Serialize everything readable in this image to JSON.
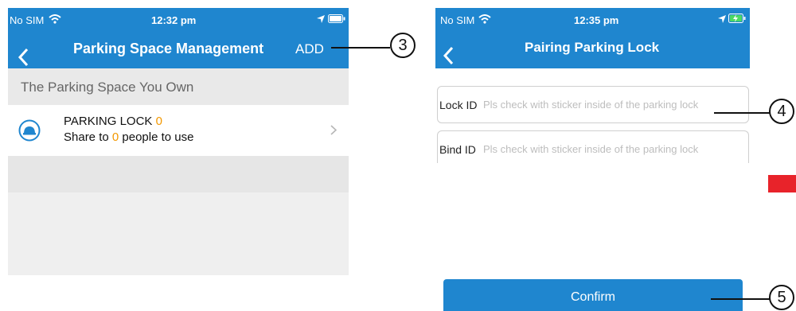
{
  "left_screen": {
    "status": {
      "carrier": "No SIM",
      "time": "12:32 pm"
    },
    "nav": {
      "title": "Parking Space Management",
      "add_label": "ADD"
    },
    "section_header": "The Parking Space You Own",
    "lock_item": {
      "title": "PARKING LOCK",
      "lock_count": "0",
      "share_prefix": "Share to",
      "share_count": "0",
      "share_suffix": "people to use"
    }
  },
  "right_screen": {
    "status": {
      "carrier": "No SIM",
      "time": "12:35 pm"
    },
    "nav": {
      "title": "Pairing Parking Lock"
    },
    "lock_id": {
      "label": "Lock ID",
      "placeholder": "Pls check with sticker inside of the parking lock"
    },
    "bind_id": {
      "label": "Bind ID",
      "placeholder": "Pls check with sticker inside of the parking lock"
    },
    "confirm_label": "Confirm"
  },
  "annotations": {
    "a3": "3",
    "a4": "4",
    "a5": "5"
  },
  "colors": {
    "nav_blue": "#1f86cf",
    "orange": "#f39800",
    "red_marker": "#e8232a"
  },
  "icons": [
    "wifi-icon",
    "location-arrow-icon",
    "battery-icon",
    "battery-charging-icon",
    "back-chevron-icon",
    "lock-icon",
    "chevron-right-icon"
  ]
}
